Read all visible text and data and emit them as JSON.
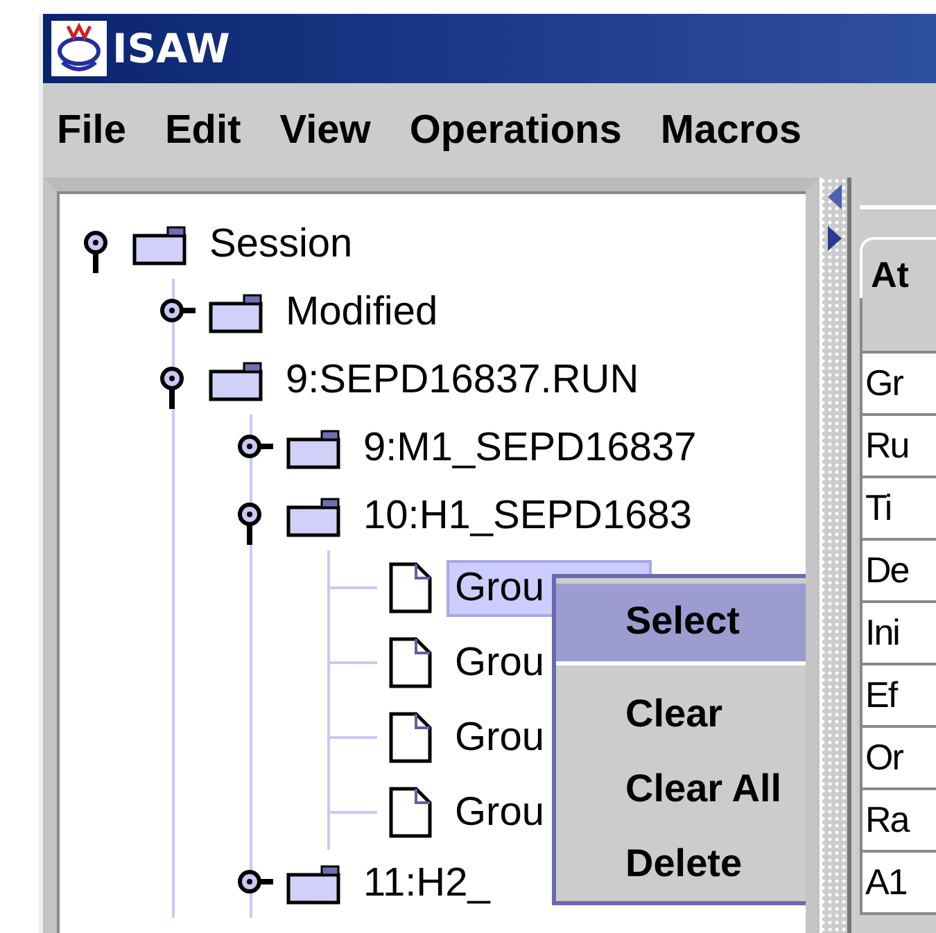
{
  "window": {
    "title": "ISAW"
  },
  "menu": [
    "File",
    "Edit",
    "View",
    "Operations",
    "Macros"
  ],
  "tree": [
    {
      "label": "Session",
      "kind": "folder",
      "expanded": true,
      "children": [
        {
          "label": "Modified",
          "kind": "folder",
          "expanded": false,
          "selected": false
        },
        {
          "label": "9:SEPD16837.RUN",
          "kind": "folder",
          "expanded": true,
          "selected": false,
          "children": [
            {
              "label": "9:M1_SEPD16837",
              "kind": "folder",
              "expanded": false,
              "selected": false
            },
            {
              "label": "10:H1_SEPD1683",
              "kind": "folder",
              "expanded": true,
              "selected": false,
              "children": [
                {
                  "label": "Grou",
                  "kind": "file",
                  "selected": true
                },
                {
                  "label": "Grou",
                  "kind": "file",
                  "selected": false
                },
                {
                  "label": "Grou",
                  "kind": "file",
                  "selected": false
                },
                {
                  "label": "Grou",
                  "kind": "file",
                  "selected": false
                }
              ]
            },
            {
              "label": "11:H2_",
              "kind": "folder",
              "expanded": false,
              "selected": false
            }
          ]
        }
      ],
      "selected": false
    }
  ],
  "context_menu": [
    {
      "label": "Select",
      "selected": true
    },
    {
      "label": "Clear",
      "selected": false
    },
    {
      "label": "Clear All",
      "selected": false
    },
    {
      "label": "Delete",
      "selected": false
    }
  ],
  "right_panel": {
    "tab": "At",
    "rows": [
      "Gr",
      "Ru",
      "Ti",
      "De",
      "Ini",
      "Ef",
      "Or",
      "Ra",
      "A1"
    ]
  }
}
